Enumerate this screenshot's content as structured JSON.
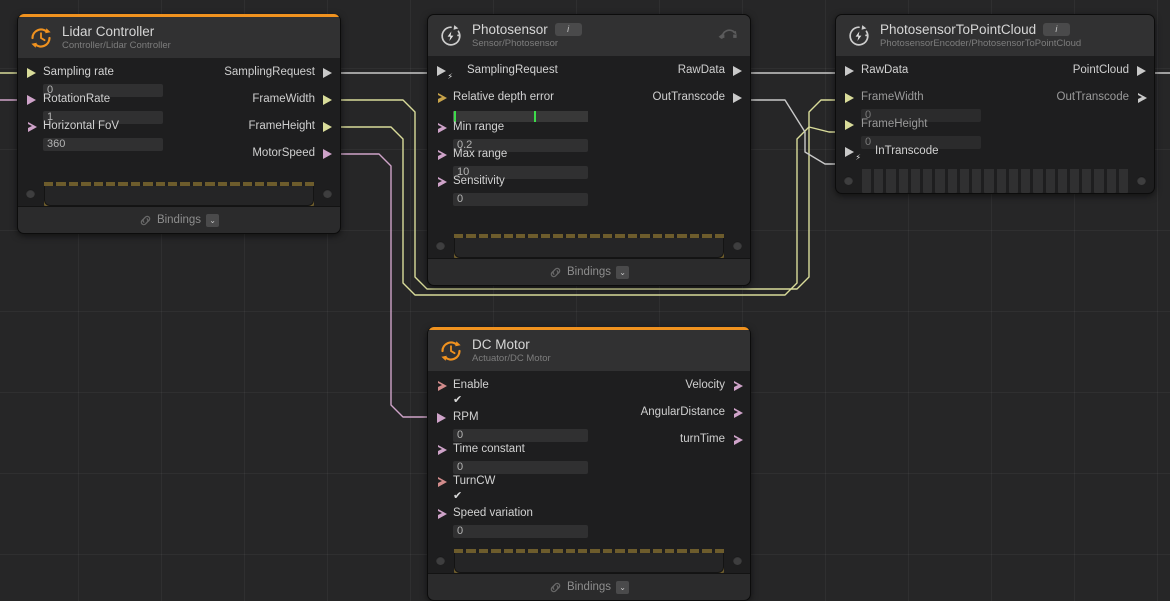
{
  "canvas": {
    "background": "#262627",
    "grid_color": "#2f2f30",
    "grid_size": 83
  },
  "wire_colors": {
    "white": "#c9c9c9",
    "yellow": "#d9dc9a",
    "pink": "#cfa3c9",
    "orange": "#f0921f",
    "green": "#3ddb4a"
  },
  "nodes": [
    {
      "id": "lidar-controller",
      "title": "Lidar Controller",
      "subtitle": "Controller/Lidar Controller",
      "icon": "clock-rotate-icon",
      "accent": "#f0921f",
      "has_info_badge": false,
      "has_gizmo": false,
      "inputs": [
        {
          "label": "Sampling rate",
          "value": "0",
          "control": "field",
          "pin": "filled",
          "color": "#d9dc9a"
        },
        {
          "label": "RotationRate",
          "value": "1",
          "control": "field",
          "pin": "filled",
          "color": "#cfa3c9"
        },
        {
          "label": "Horizontal FoV",
          "value": "360",
          "control": "field",
          "pin": "hollow",
          "color": "#cfa3c9"
        }
      ],
      "outputs": [
        {
          "label": "SamplingRequest",
          "pin": "filled",
          "color": "#c9c9c9"
        },
        {
          "label": "FrameWidth",
          "pin": "filled",
          "color": "#d9dc9a"
        },
        {
          "label": "FrameHeight",
          "pin": "filled",
          "color": "#d9dc9a"
        },
        {
          "label": "MotorSpeed",
          "pin": "filled",
          "color": "#cfa3c9"
        }
      ],
      "connector_active": true,
      "bindings": {
        "label": "Bindings",
        "icon": "link-icon",
        "chevron": "⌄"
      }
    },
    {
      "id": "photosensor",
      "title": "Photosensor",
      "subtitle": "Sensor/Photosensor",
      "icon": "bolt-rotate-icon",
      "accent": null,
      "has_info_badge": true,
      "info_badge": "i",
      "has_gizmo": true,
      "gizmo_icon": "transform-gizmo-icon",
      "inputs": [
        {
          "label": "SamplingRequest",
          "control": "none",
          "pin": "filled",
          "color": "#c9c9c9",
          "bolt": true
        },
        {
          "label": "Relative depth error",
          "control": "slider",
          "slider_value": 60,
          "pin": "hollow",
          "color": "#c8a34a"
        },
        {
          "label": "Min range",
          "value": "0.2",
          "control": "field",
          "pin": "hollow",
          "color": "#cfa3c9"
        },
        {
          "label": "Max range",
          "value": "10",
          "control": "field",
          "pin": "hollow",
          "color": "#cfa3c9"
        },
        {
          "label": "Sensitivity",
          "value": "0",
          "control": "field",
          "pin": "hollow",
          "color": "#cfa3c9"
        }
      ],
      "outputs": [
        {
          "label": "RawData",
          "pin": "filled",
          "color": "#c9c9c9"
        },
        {
          "label": "OutTranscode",
          "pin": "filled",
          "color": "#c9c9c9"
        }
      ],
      "connector_active": true,
      "bindings": {
        "label": "Bindings",
        "icon": "link-icon",
        "chevron": "⌄"
      }
    },
    {
      "id": "photosensor-to-point-cloud",
      "title": "PhotosensorToPointCloud",
      "subtitle": "PhotosensorEncoder/PhotosensorToPointCloud",
      "icon": "bolt-rotate-icon",
      "accent": null,
      "has_info_badge": true,
      "info_badge": "i",
      "has_gizmo": false,
      "inputs": [
        {
          "label": "RawData",
          "control": "none",
          "pin": "filled",
          "color": "#c9c9c9"
        },
        {
          "label": "FrameWidth",
          "value": "0",
          "control": "field",
          "pin": "filled",
          "color": "#d9dc9a"
        },
        {
          "label": "FrameHeight",
          "value": "0",
          "control": "field",
          "pin": "filled",
          "color": "#d9dc9a"
        },
        {
          "label": "InTranscode",
          "control": "none",
          "pin": "filled",
          "color": "#c9c9c9",
          "bolt": true
        }
      ],
      "outputs": [
        {
          "label": "PointCloud",
          "pin": "filled",
          "color": "#c9c9c9"
        },
        {
          "label": "OutTranscode",
          "pin": "hollow",
          "color": "#c9c9c9"
        }
      ],
      "connector_active": false,
      "bindings": null
    },
    {
      "id": "dc-motor",
      "title": "DC Motor",
      "subtitle": "Actuator/DC Motor",
      "icon": "clock-rotate-icon",
      "accent": "#f0921f",
      "has_info_badge": false,
      "has_gizmo": false,
      "inputs": [
        {
          "label": "Enable",
          "value": "✔",
          "control": "check",
          "pin": "hollow",
          "color": "#d28c8c"
        },
        {
          "label": "RPM",
          "value": "0",
          "control": "field",
          "pin": "filled",
          "color": "#cfa3c9"
        },
        {
          "label": "Time constant",
          "value": "0",
          "control": "field",
          "pin": "hollow",
          "color": "#cfa3c9"
        },
        {
          "label": "TurnCW",
          "value": "✔",
          "control": "check",
          "pin": "hollow",
          "color": "#d28c8c"
        },
        {
          "label": "Speed variation",
          "value": "0",
          "control": "field",
          "pin": "hollow",
          "color": "#cfa3c9"
        }
      ],
      "outputs": [
        {
          "label": "Velocity",
          "pin": "hollow",
          "color": "#cfa3c9"
        },
        {
          "label": "AngularDistance",
          "pin": "hollow",
          "color": "#cfa3c9"
        },
        {
          "label": "turnTime",
          "pin": "hollow",
          "color": "#cfa3c9"
        }
      ],
      "connector_active": true,
      "bindings": {
        "label": "Bindings",
        "icon": "link-icon",
        "chevron": "⌄"
      }
    }
  ]
}
